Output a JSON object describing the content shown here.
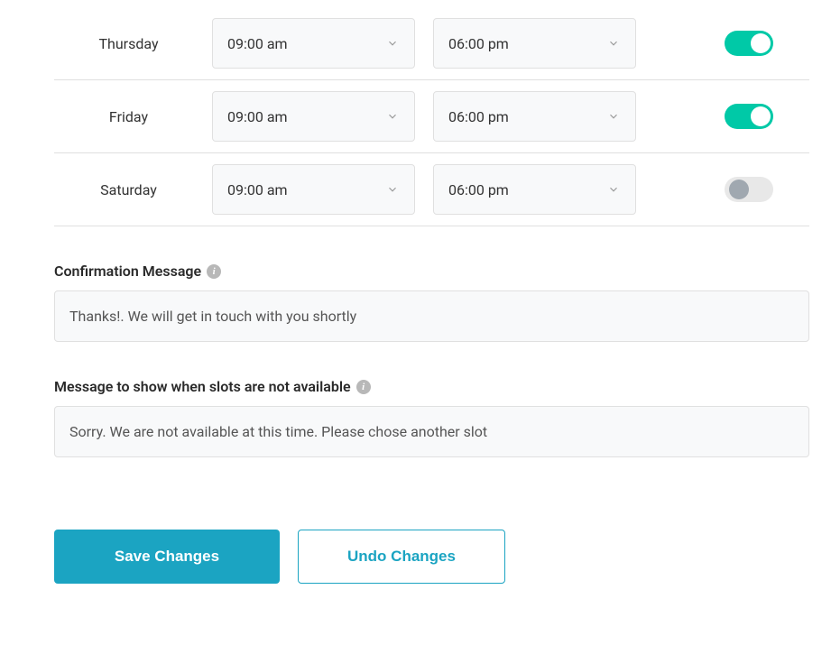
{
  "schedule": {
    "rows": [
      {
        "day": "Thursday",
        "start": "09:00 am",
        "end": "06:00 pm",
        "enabled": true
      },
      {
        "day": "Friday",
        "start": "09:00 am",
        "end": "06:00 pm",
        "enabled": true
      },
      {
        "day": "Saturday",
        "start": "09:00 am",
        "end": "06:00 pm",
        "enabled": false
      }
    ]
  },
  "confirmation": {
    "label": "Confirmation Message",
    "value": "Thanks!. We will get in touch with you shortly"
  },
  "unavailable": {
    "label": "Message to show when slots are not available",
    "value": "Sorry. We are not available at this time. Please chose another slot"
  },
  "buttons": {
    "save": "Save Changes",
    "undo": "Undo Changes"
  }
}
